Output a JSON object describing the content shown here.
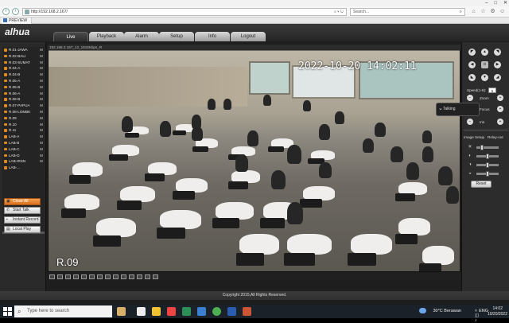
{
  "browser": {
    "address": "http://192.168.2.167/",
    "search_placeholder": "Search...",
    "tab_title": "PREVIEW",
    "controls": [
      "–",
      "□",
      "✕"
    ]
  },
  "app": {
    "brand": "alhua",
    "tabs": [
      {
        "label": "Live",
        "active": true
      },
      {
        "label": "Playback",
        "active": false
      },
      {
        "label": "Alarm",
        "active": false
      },
      {
        "label": "Setup",
        "active": false
      },
      {
        "label": "Info",
        "active": false
      },
      {
        "label": "Logout",
        "active": false
      }
    ],
    "accent_color": "#e28b1b"
  },
  "channels": [
    {
      "name": "R.01-JAWA",
      "flag": "M"
    },
    {
      "name": "R.02-BALI",
      "flag": "M"
    },
    {
      "name": "R.03-SUMAT",
      "flag": "M"
    },
    {
      "name": "R.04-A",
      "flag": "M"
    },
    {
      "name": "R.04-B",
      "flag": "M"
    },
    {
      "name": "R.05-A",
      "flag": "M"
    },
    {
      "name": "R.05-B",
      "flag": "M"
    },
    {
      "name": "R.06-A",
      "flag": "M"
    },
    {
      "name": "R.06-B",
      "flag": "M"
    },
    {
      "name": "R.07-PAPUA",
      "flag": "M"
    },
    {
      "name": "R.08-LOMBK",
      "flag": "M"
    },
    {
      "name": "R.09",
      "flag": "M"
    },
    {
      "name": "R.10",
      "flag": "M"
    },
    {
      "name": "R.11",
      "flag": "M"
    },
    {
      "name": "LAB-A",
      "flag": "M"
    },
    {
      "name": "LAB-B",
      "flag": "M"
    },
    {
      "name": "LAB-C",
      "flag": "M"
    },
    {
      "name": "LAB-D",
      "flag": "M"
    },
    {
      "name": "LAB-IRSN",
      "flag": "M"
    },
    {
      "name": "LAB-...",
      "flag": ""
    }
  ],
  "left_buttons": {
    "close_all": "Close All",
    "start_talk": "Start Talk",
    "instant_record": "Instant Record",
    "local_play": "Local Play"
  },
  "video": {
    "header": "192.168.2.167_12_1816Kbps_R",
    "timestamp": "2022-10-20 14:02:11",
    "camera_name": "R.09",
    "talking_label": "Talking"
  },
  "ptz": {
    "speed_label": "Speed(1-8):",
    "speed_value": "5",
    "zoom_label": "Zoom",
    "focus_label": "Focus",
    "iris_label": "Iris",
    "minus": "−",
    "plus": "+",
    "image_setup_label": "Image Setup",
    "relay_out_label": "Relay-out",
    "reset_label": "Reset",
    "sliders": [
      0.2,
      0.5,
      0.5,
      0.5
    ]
  },
  "footer": {
    "copyright": "Copyright 2015,All Rights Reserved."
  },
  "taskbar": {
    "search_placeholder": "Type here to search",
    "weather": "30°C  Berawan",
    "time": "14:02",
    "date": "10/20/2022",
    "language": "ENG"
  }
}
